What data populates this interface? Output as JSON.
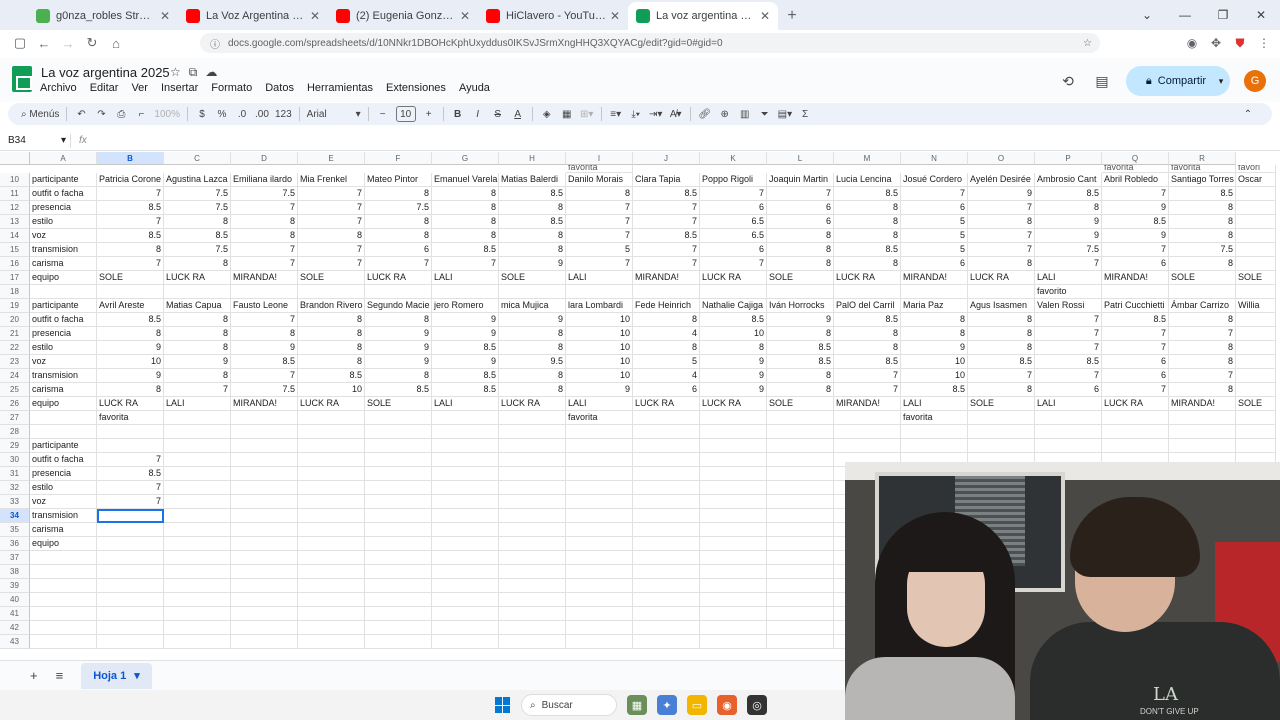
{
  "browser": {
    "tabs": [
      {
        "title": "g0nza_robles Stream - Watch Li",
        "color": "#4caf50",
        "active": false
      },
      {
        "title": "La Voz Argentina - YouTube",
        "color": "#ff0000",
        "active": false
      },
      {
        "title": "(2) Eugenia González - \"Gloria\"",
        "color": "#ff0000",
        "active": false
      },
      {
        "title": "HiClavero - YouTube",
        "color": "#ff0000",
        "active": false
      },
      {
        "title": "La voz argentina 2025 - Hojas d",
        "color": "#0f9d58",
        "active": true
      }
    ],
    "url": "docs.google.com/spreadsheets/d/10NNkr1DBOHcKphUxyddus0IKSvJSrmXngHHQ3XQYACg/edit?gid=0#gid=0"
  },
  "app": {
    "doc_title": "La voz argentina 2025",
    "menu": [
      "Archivo",
      "Editar",
      "Ver",
      "Insertar",
      "Formato",
      "Datos",
      "Herramientas",
      "Extensiones",
      "Ayuda"
    ],
    "share_label": "Compartir",
    "avatar_letter": "G"
  },
  "toolbar": {
    "menus_label": "Menús",
    "zoom": "100%",
    "currency": "$",
    "percent": "%",
    "dec_less": ".0",
    "dec_more": ".00",
    "num_format": "123",
    "font": "Arial",
    "font_size": "10"
  },
  "formula_bar": {
    "name_box": "B34",
    "fx": "fx"
  },
  "grid": {
    "columns": [
      "A",
      "B",
      "C",
      "D",
      "E",
      "F",
      "G",
      "H",
      "I",
      "J",
      "K",
      "L",
      "M",
      "N",
      "O",
      "P",
      "Q",
      "R"
    ],
    "selected_col": "B",
    "selected_row": "34",
    "partial_top": [
      "",
      "",
      "",
      "",
      "",
      "",
      "",
      "",
      "favorita",
      "",
      "",
      "",
      "",
      "",
      "",
      "",
      "favorita",
      "favorita",
      "favori"
    ],
    "rows": [
      {
        "n": "10",
        "cells": [
          "participante",
          "Patricia Corone",
          "Agustina Lazca",
          "Emiliana ilardo",
          "Mia Frenkel",
          "Mateo Pintor",
          "Emanuel Varela",
          "Matias Balerdi",
          "Danilo Morais",
          "Clara Tapia",
          "Poppo Rigoli",
          "Joaquin Martin",
          "Lucia Lencina",
          "Josué Cordero",
          "Ayelén Desirée",
          "Ambrosio Cant",
          "Abril Robledo",
          "Santiago Torres",
          "Oscar"
        ]
      },
      {
        "n": "11",
        "cells": [
          "outfit o facha",
          "7",
          "7.5",
          "7.5",
          "7",
          "8",
          "8",
          "8.5",
          "8",
          "8.5",
          "7",
          "7",
          "8.5",
          "7",
          "9",
          "8.5",
          "7",
          "8.5",
          ""
        ]
      },
      {
        "n": "12",
        "cells": [
          "presencia",
          "8.5",
          "7.5",
          "7",
          "7",
          "7.5",
          "8",
          "8",
          "7",
          "7",
          "6",
          "6",
          "8",
          "6",
          "7",
          "8",
          "9",
          "8",
          ""
        ]
      },
      {
        "n": "13",
        "cells": [
          "estilo",
          "7",
          "8",
          "8",
          "7",
          "8",
          "8",
          "8.5",
          "7",
          "7",
          "6.5",
          "6",
          "8",
          "5",
          "8",
          "9",
          "8.5",
          "8",
          ""
        ]
      },
      {
        "n": "14",
        "cells": [
          "voz",
          "8.5",
          "8.5",
          "8",
          "8",
          "8",
          "8",
          "8",
          "7",
          "8.5",
          "6.5",
          "8",
          "8",
          "5",
          "7",
          "9",
          "9",
          "8",
          ""
        ]
      },
      {
        "n": "15",
        "cells": [
          "transmision",
          "8",
          "7.5",
          "7",
          "7",
          "6",
          "8.5",
          "8",
          "5",
          "7",
          "6",
          "8",
          "8.5",
          "5",
          "7",
          "7.5",
          "7",
          "7.5",
          ""
        ]
      },
      {
        "n": "16",
        "cells": [
          "carisma",
          "7",
          "8",
          "7",
          "7",
          "7",
          "7",
          "9",
          "7",
          "7",
          "7",
          "8",
          "8",
          "6",
          "8",
          "7",
          "6",
          "8",
          ""
        ]
      },
      {
        "n": "17",
        "cells": [
          "equipo",
          "SOLE",
          "LUCK RA",
          "MIRANDA!",
          "SOLE",
          "LUCK RA",
          "LALI",
          "SOLE",
          "LALI",
          "MIRANDA!",
          "LUCK RA",
          "SOLE",
          "LUCK RA",
          "MIRANDA!",
          "LUCK RA",
          "LALI",
          "MIRANDA!",
          "SOLE",
          "SOLE"
        ]
      },
      {
        "n": "18",
        "cells": [
          "",
          "",
          "",
          "",
          "",
          "",
          "",
          "",
          "",
          "",
          "",
          "",
          "",
          "",
          "",
          "favorito",
          "",
          "",
          ""
        ]
      },
      {
        "n": "19",
        "cells": [
          "participante",
          "Avril Areste",
          "Matias Capua",
          "Fausto Leone",
          "Brandon Rivero",
          "Segundo Macie",
          "jero Romero",
          "mica Mujica",
          "lara Lombardi",
          "Fede Heinrich",
          "Nathalie Cajiga",
          "Iván Horrocks",
          "PalO del Carril",
          "Maria Paz",
          "Agus Isasmen",
          "Valen Rossi",
          "Patri Cucchietti",
          "Ámbar Carrizo",
          "Willia"
        ]
      },
      {
        "n": "20",
        "cells": [
          "outfit o facha",
          "8.5",
          "8",
          "7",
          "8",
          "8",
          "9",
          "9",
          "10",
          "8",
          "8.5",
          "9",
          "8.5",
          "8",
          "8",
          "7",
          "8.5",
          "8",
          ""
        ]
      },
      {
        "n": "21",
        "cells": [
          "presencia",
          "8",
          "8",
          "8",
          "8",
          "9",
          "9",
          "8",
          "10",
          "4",
          "10",
          "8",
          "8",
          "8",
          "8",
          "7",
          "7",
          "7",
          ""
        ]
      },
      {
        "n": "22",
        "cells": [
          "estilo",
          "9",
          "8",
          "9",
          "8",
          "9",
          "8.5",
          "8",
          "10",
          "8",
          "8",
          "8.5",
          "8",
          "9",
          "8",
          "7",
          "7",
          "8",
          ""
        ]
      },
      {
        "n": "23",
        "cells": [
          "voz",
          "10",
          "9",
          "8.5",
          "8",
          "9",
          "9",
          "9.5",
          "10",
          "5",
          "9",
          "8.5",
          "8.5",
          "10",
          "8.5",
          "8.5",
          "6",
          "8",
          ""
        ]
      },
      {
        "n": "24",
        "cells": [
          "transmision",
          "9",
          "8",
          "7",
          "8.5",
          "8",
          "8.5",
          "8",
          "10",
          "4",
          "9",
          "8",
          "7",
          "10",
          "7",
          "7",
          "6",
          "7",
          ""
        ]
      },
      {
        "n": "25",
        "cells": [
          "carisma",
          "8",
          "7",
          "7.5",
          "10",
          "8.5",
          "8.5",
          "8",
          "9",
          "6",
          "9",
          "8",
          "7",
          "8.5",
          "8",
          "6",
          "7",
          "8",
          ""
        ]
      },
      {
        "n": "26",
        "cells": [
          "equipo",
          "LUCK RA",
          "LALI",
          "MIRANDA!",
          "LUCK RA",
          "SOLE",
          "LALI",
          "LUCK RA",
          "LALI",
          "LUCK RA",
          "LUCK RA",
          "SOLE",
          "MIRANDA!",
          "LALI",
          "SOLE",
          "LALI",
          "LUCK RA",
          "MIRANDA!",
          "SOLE"
        ]
      },
      {
        "n": "27",
        "cells": [
          "",
          "favorita",
          "",
          "",
          "",
          "",
          "",
          "",
          "favorita",
          "",
          "",
          "",
          "",
          "favorita",
          "",
          "",
          "",
          "",
          ""
        ]
      },
      {
        "n": "28",
        "cells": [
          "",
          "",
          "",
          "",
          "",
          "",
          "",
          "",
          "",
          "",
          "",
          "",
          "",
          "",
          "",
          "",
          "",
          "",
          ""
        ]
      },
      {
        "n": "29",
        "cells": [
          "participante",
          "",
          "",
          "",
          "",
          "",
          "",
          "",
          "",
          "",
          "",
          "",
          "",
          "",
          "",
          "",
          "",
          "",
          ""
        ]
      },
      {
        "n": "30",
        "cells": [
          "outfit o facha",
          "7",
          "",
          "",
          "",
          "",
          "",
          "",
          "",
          "",
          "",
          "",
          "",
          "",
          "",
          "",
          "",
          "",
          ""
        ]
      },
      {
        "n": "31",
        "cells": [
          "presencia",
          "8.5",
          "",
          "",
          "",
          "",
          "",
          "",
          "",
          "",
          "",
          "",
          "",
          "",
          "",
          "",
          "",
          "",
          ""
        ]
      },
      {
        "n": "32",
        "cells": [
          "estilo",
          "7",
          "",
          "",
          "",
          "",
          "",
          "",
          "",
          "",
          "",
          "",
          "",
          "",
          "",
          "",
          "",
          "",
          ""
        ]
      },
      {
        "n": "33",
        "cells": [
          "voz",
          "7",
          "",
          "",
          "",
          "",
          "",
          "",
          "",
          "",
          "",
          "",
          "",
          "",
          "",
          "",
          "",
          "",
          ""
        ]
      },
      {
        "n": "34",
        "cells": [
          "transmision",
          "",
          "",
          "",
          "",
          "",
          "",
          "",
          "",
          "",
          "",
          "",
          "",
          "",
          "",
          "",
          "",
          "",
          ""
        ]
      },
      {
        "n": "35",
        "cells": [
          "carisma",
          "",
          "",
          "",
          "",
          "",
          "",
          "",
          "",
          "",
          "",
          "",
          "",
          "",
          "",
          "",
          "",
          "",
          ""
        ]
      },
      {
        "n": "36",
        "cells": [
          "equipo",
          "",
          "",
          "",
          "",
          "",
          "",
          "",
          "",
          "",
          "",
          "",
          "",
          "",
          "",
          "",
          "",
          "",
          ""
        ]
      },
      {
        "n": "37",
        "cells": [
          "",
          "",
          "",
          "",
          "",
          "",
          "",
          "",
          "",
          "",
          "",
          "",
          "",
          "",
          "",
          "",
          "",
          "",
          ""
        ]
      },
      {
        "n": "38",
        "cells": [
          "",
          "",
          "",
          "",
          "",
          "",
          "",
          "",
          "",
          "",
          "",
          "",
          "",
          "",
          "",
          "",
          "",
          "",
          ""
        ]
      },
      {
        "n": "39",
        "cells": [
          "",
          "",
          "",
          "",
          "",
          "",
          "",
          "",
          "",
          "",
          "",
          "",
          "",
          "",
          "",
          "",
          "",
          "",
          ""
        ]
      },
      {
        "n": "40",
        "cells": [
          "",
          "",
          "",
          "",
          "",
          "",
          "",
          "",
          "",
          "",
          "",
          "",
          "",
          "",
          "",
          "",
          "",
          "",
          ""
        ]
      },
      {
        "n": "41",
        "cells": [
          "",
          "",
          "",
          "",
          "",
          "",
          "",
          "",
          "",
          "",
          "",
          "",
          "",
          "",
          "",
          "",
          "",
          "",
          ""
        ]
      },
      {
        "n": "42",
        "cells": [
          "",
          "",
          "",
          "",
          "",
          "",
          "",
          "",
          "",
          "",
          "",
          "",
          "",
          "",
          "",
          "",
          "",
          "",
          ""
        ]
      },
      {
        "n": "43",
        "cells": [
          "",
          "",
          "",
          "",
          "",
          "",
          "",
          "",
          "",
          "",
          "",
          "",
          "",
          "",
          "",
          "",
          "",
          "",
          ""
        ]
      }
    ]
  },
  "sheets": {
    "add_icon": "plus-icon",
    "list_icon": "list-icon",
    "active_sheet": "Hoja 1"
  },
  "taskbar": {
    "search_label": "Buscar"
  },
  "webcam": {
    "shirt_text": "LA",
    "shirt_sub": "DON'T GIVE UP"
  }
}
